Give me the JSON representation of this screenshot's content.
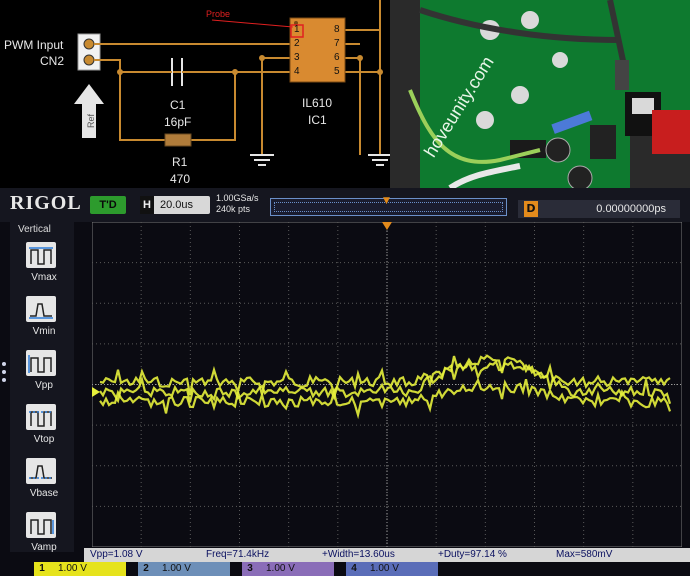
{
  "schematic": {
    "pwm_label_line1": "PWM Input",
    "pwm_label_line2": "CN2",
    "ref_label": "Ref",
    "probe_label": "Probe",
    "c1_name": "C1",
    "c1_value": "16pF",
    "r1_name": "R1",
    "r1_value": "470",
    "ic_name": "IL610",
    "ic_ref": "IC1",
    "pins_left": [
      "1",
      "2",
      "3",
      "4"
    ],
    "pins_right": [
      "8",
      "7",
      "6",
      "5"
    ]
  },
  "photo": {
    "board_text": "hoveunity.com"
  },
  "scope": {
    "brand": "RIGOL",
    "trigger_state": "T'D",
    "timebase_key": "H",
    "timebase_value": "20.0us",
    "sample_rate": "1.00GSa/s",
    "memory_depth": "240k pts",
    "delay_key": "D",
    "delay_value": "0.00000000ps",
    "menu_title": "Vertical",
    "menu_items": [
      "Vmax",
      "Vmin",
      "Vpp",
      "Vtop",
      "Vbase",
      "Vamp"
    ],
    "measurements": {
      "vpp": "Vpp=1.08 V",
      "freq": "Freq=71.4kHz",
      "width": "+Width=13.60us",
      "duty": "+Duty=97.14 %",
      "max": "Max=580mV"
    },
    "channels": [
      {
        "num": "1",
        "scale": "1.00 V",
        "color": "#e6e31c"
      },
      {
        "num": "2",
        "scale": "1.00 V",
        "color": "#1cc8e6"
      },
      {
        "num": "3",
        "scale": "1.00 V",
        "color": "#c82ee6"
      },
      {
        "num": "4",
        "scale": "1.00 V",
        "color": "#2e6ce6"
      }
    ],
    "trace_color": "#e6f03c",
    "trigger_color": "#e38b1c"
  }
}
